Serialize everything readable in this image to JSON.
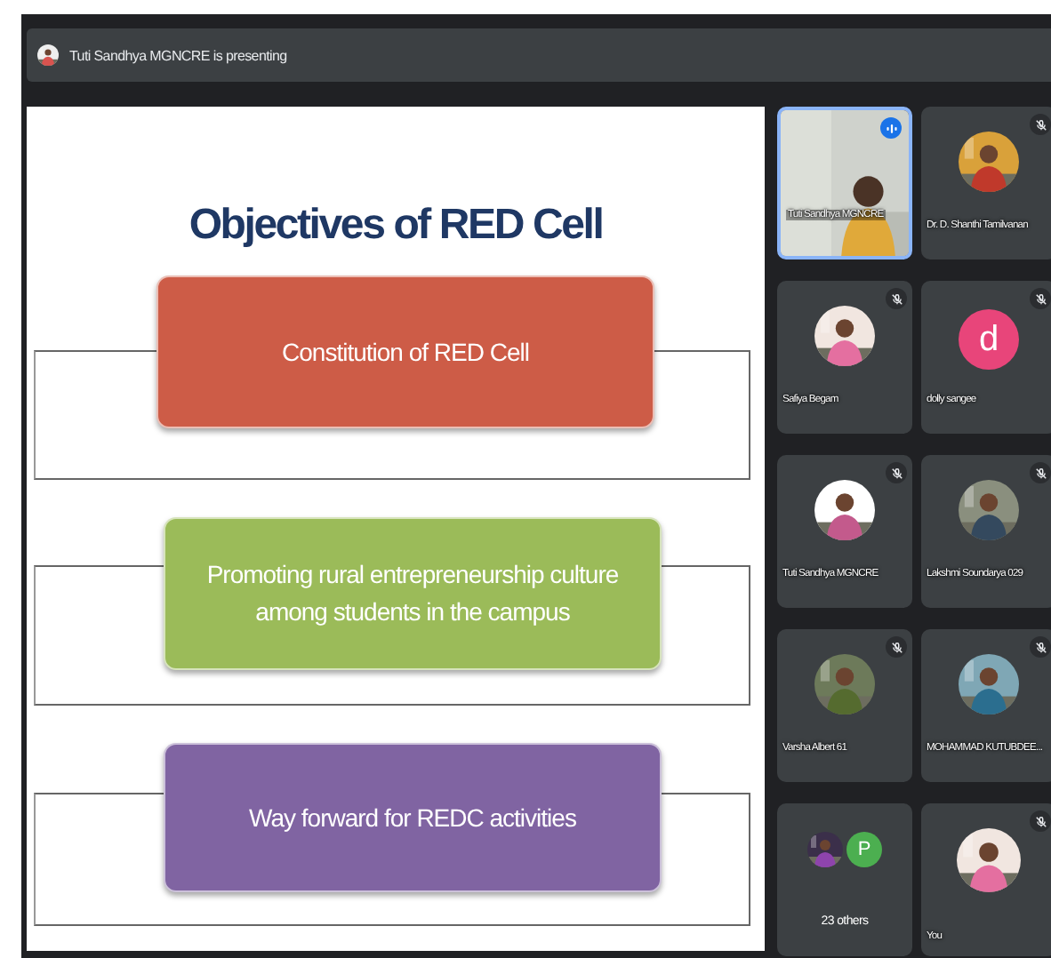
{
  "header": {
    "presenter_text": "Tuti Sandhya MGNCRE is presenting"
  },
  "slide": {
    "title": "Objectives of RED Cell",
    "items": [
      {
        "text": "Constitution of RED Cell",
        "color": "#cd5c47"
      },
      {
        "text": "Promoting rural entrepreneurship culture among students in the campus",
        "color": "#9bbb59"
      },
      {
        "text": "Way forward for REDC activities",
        "color": "#8064a2"
      }
    ]
  },
  "tiles": [
    {
      "kind": "video",
      "name": "Tuti Sandhya MGNCRE",
      "speaking": true
    },
    {
      "name": "Dr. D. Shanthi Tamilvanan",
      "muted": true
    },
    {
      "name": "Safiya Begam",
      "muted": true
    },
    {
      "kind": "letter",
      "letter": "d",
      "color": "#e8457a",
      "name": "dolly sangee",
      "muted": true
    },
    {
      "name": "Tuti Sandhya MGNCRE",
      "muted": true
    },
    {
      "name": "Lakshmi Soundarya 029",
      "muted": true
    },
    {
      "name": "Varsha Albert 61",
      "muted": true
    },
    {
      "name": "MOHAMMAD KUTUBDEE...",
      "muted": true
    },
    {
      "kind": "others",
      "letter": "P",
      "color": "#4caf50",
      "name": "23 others"
    },
    {
      "name": "You",
      "muted": true
    }
  ]
}
